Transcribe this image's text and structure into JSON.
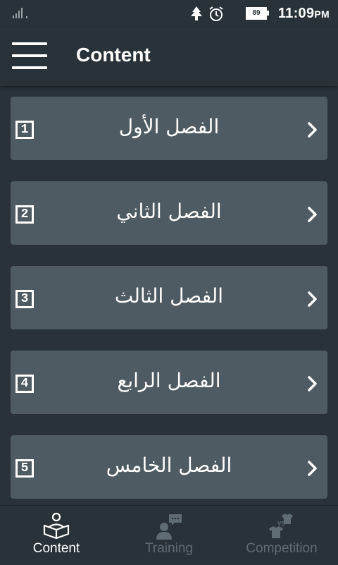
{
  "status_bar": {
    "battery_level": "89",
    "time": "11:09",
    "time_suffix": "PM"
  },
  "app_bar": {
    "menu_icon": "hamburger-menu-icon",
    "title": "Content"
  },
  "chapters": [
    {
      "number": "1",
      "label": "الفصل الأول"
    },
    {
      "number": "2",
      "label": "الفصل الثاني"
    },
    {
      "number": "3",
      "label": "الفصل الثالث"
    },
    {
      "number": "4",
      "label": "الفصل الرابع"
    },
    {
      "number": "5",
      "label": "الفصل الخامس"
    }
  ],
  "bottom_nav": {
    "items": [
      {
        "label": "Content",
        "icon": "reader-book-icon",
        "active": true
      },
      {
        "label": "Training",
        "icon": "person-chat-icon",
        "active": false
      },
      {
        "label": "Competition",
        "icon": "versus-shirts-icon",
        "active": false
      }
    ]
  },
  "colors": {
    "background": "#283238",
    "card": "#4e5b63",
    "inactive_nav": "#5f6c74"
  }
}
